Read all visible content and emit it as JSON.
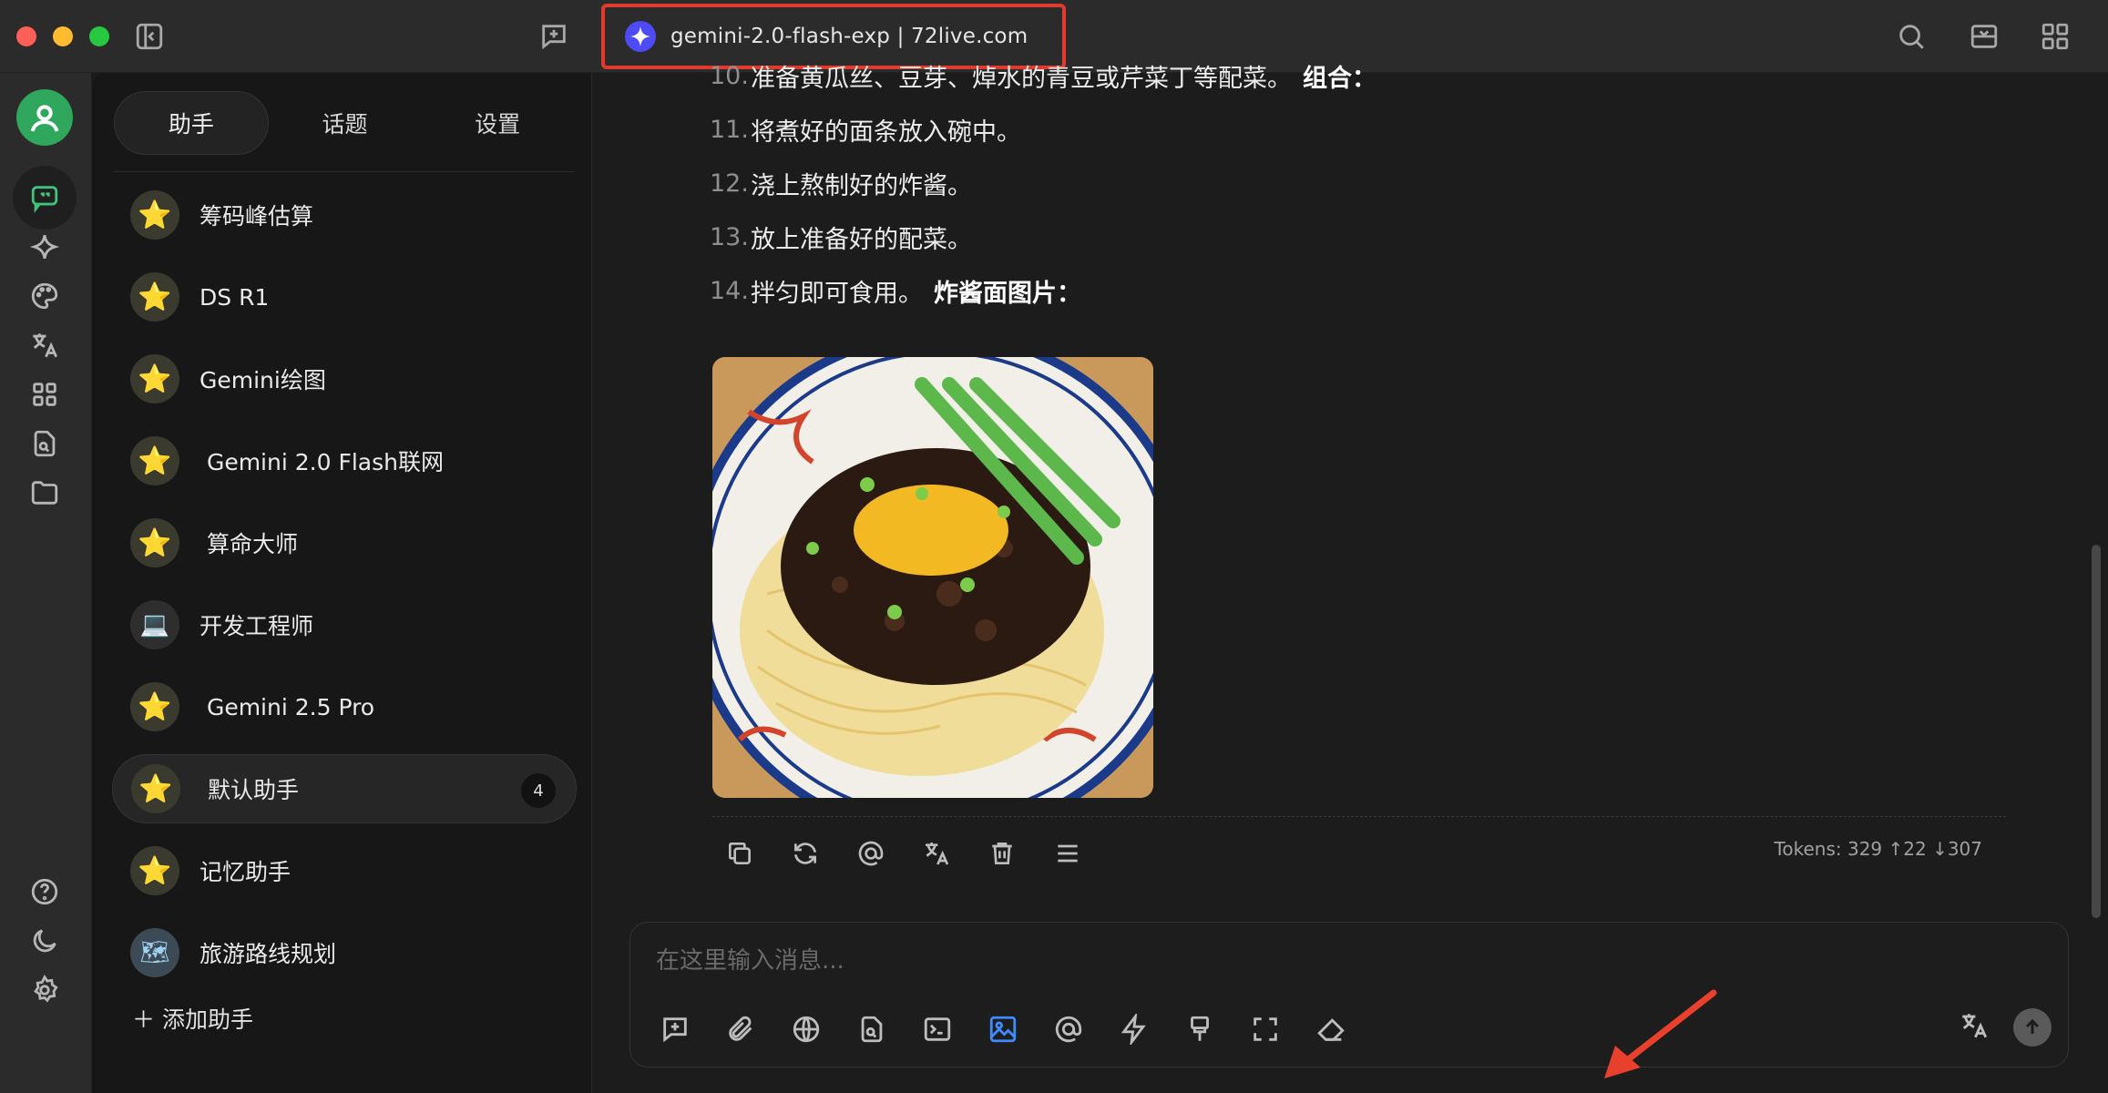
{
  "window": {
    "model_title": "gemini-2.0-flash-exp | 72live.com"
  },
  "sidebar": {
    "tabs": [
      {
        "label": "助手"
      },
      {
        "label": "话题"
      },
      {
        "label": "设置"
      }
    ],
    "assistants": [
      {
        "name": "筹码峰估算",
        "emoji": "⭐"
      },
      {
        "name": "DS R1",
        "emoji": "⭐"
      },
      {
        "name": "Gemini绘图",
        "emoji": "⭐"
      },
      {
        "name": " Gemini 2.0 Flash联网",
        "emoji": "⭐"
      },
      {
        "name": " 算命大师",
        "emoji": "⭐"
      },
      {
        "name": "开发工程师",
        "emoji": "💻"
      },
      {
        "name": " Gemini 2.5 Pro",
        "emoji": "⭐"
      },
      {
        "name": " 默认助手",
        "emoji": "⭐",
        "badge": "4"
      },
      {
        "name": "记忆助手",
        "emoji": "⭐"
      },
      {
        "name": "旅游路线规划",
        "emoji": "🗺"
      }
    ],
    "add_label": "添加助手"
  },
  "message": {
    "steps": [
      {
        "num": "10.",
        "text": "准备黄瓜丝、豆芽、焯水的青豆或芹菜丁等配菜。",
        "bold": "组合："
      },
      {
        "num": "11.",
        "text": "将煮好的面条放入碗中。",
        "bold": ""
      },
      {
        "num": "12.",
        "text": "浇上熬制好的炸酱。",
        "bold": ""
      },
      {
        "num": "13.",
        "text": "放上准备好的配菜。",
        "bold": ""
      },
      {
        "num": "14.",
        "text": "拌匀即可食用。",
        "bold": "炸酱面图片："
      }
    ],
    "tokens": "Tokens: 329 ↑22 ↓307"
  },
  "composer": {
    "placeholder": "在这里输入消息..."
  }
}
